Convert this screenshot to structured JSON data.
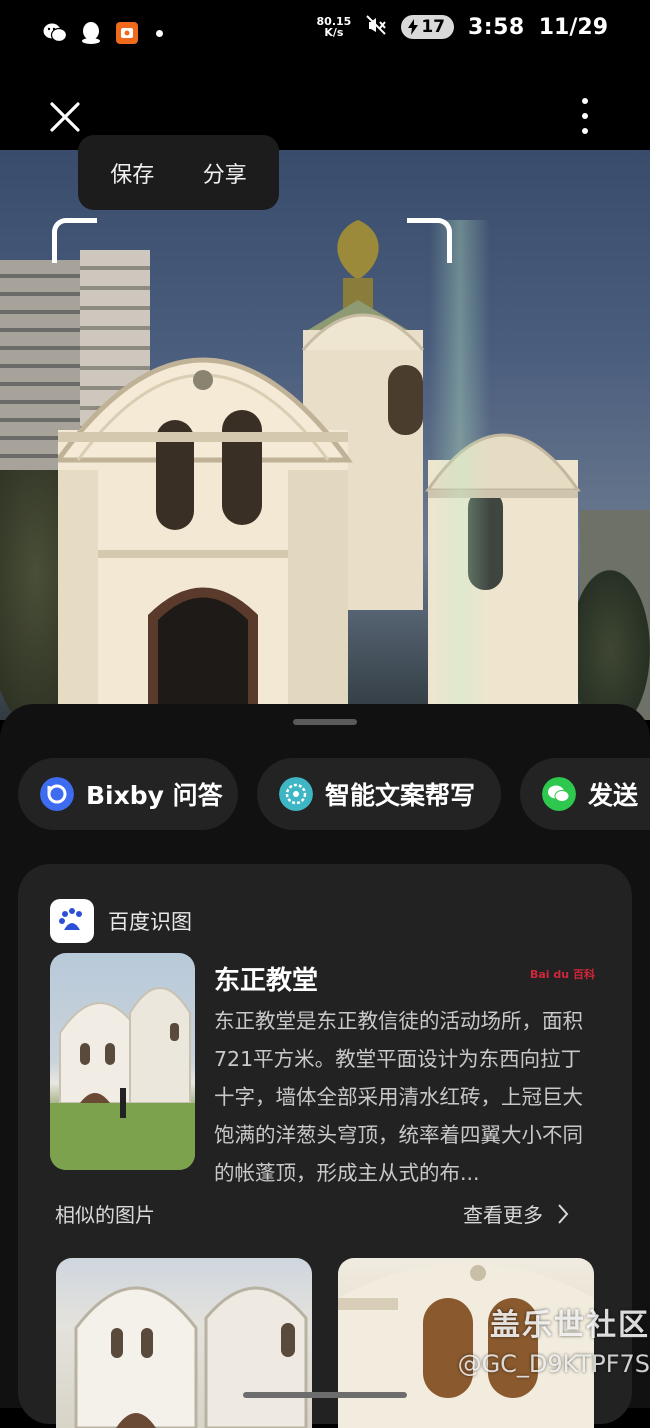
{
  "status_bar": {
    "net_speed_value": "80.15",
    "net_speed_unit": "K/s",
    "battery": "17",
    "time": "3:58",
    "date": "11/29",
    "icons": [
      "wechat-icon",
      "qq-icon",
      "app-icon",
      "mute-icon",
      "battery-charging-icon"
    ]
  },
  "popup": {
    "save_label": "保存",
    "share_label": "分享"
  },
  "chips": [
    {
      "label": "Bixby 问答",
      "icon": "bixby-icon"
    },
    {
      "label": "智能文案帮写",
      "icon": "ai-writing-icon"
    },
    {
      "label": "发送",
      "icon": "wechat-icon"
    }
  ],
  "result_card": {
    "source_name": "百度识图",
    "title": "东正教堂",
    "badge": "Bai du 百科",
    "description": "东正教堂是东正教信徒的活动场所，面积721平方米。教堂平面设计为东西向拉丁十字，墙体全部采用清水红砖，上冠巨大饱满的洋葱头穹顶，统率着四翼大小不同的帐蓬顶，形成主从式的布...",
    "similar_label": "相似的图片",
    "more_label": "查看更多"
  },
  "watermark": {
    "line1": "盖乐世社区",
    "line2": "@GC_D9KTPF7S"
  },
  "colors": {
    "sheet": "#111111",
    "card": "#222222",
    "chip": "#232323",
    "bixby": "#3d6cf0",
    "ai": "#3fb6c4",
    "wechat": "#2dc84d"
  }
}
